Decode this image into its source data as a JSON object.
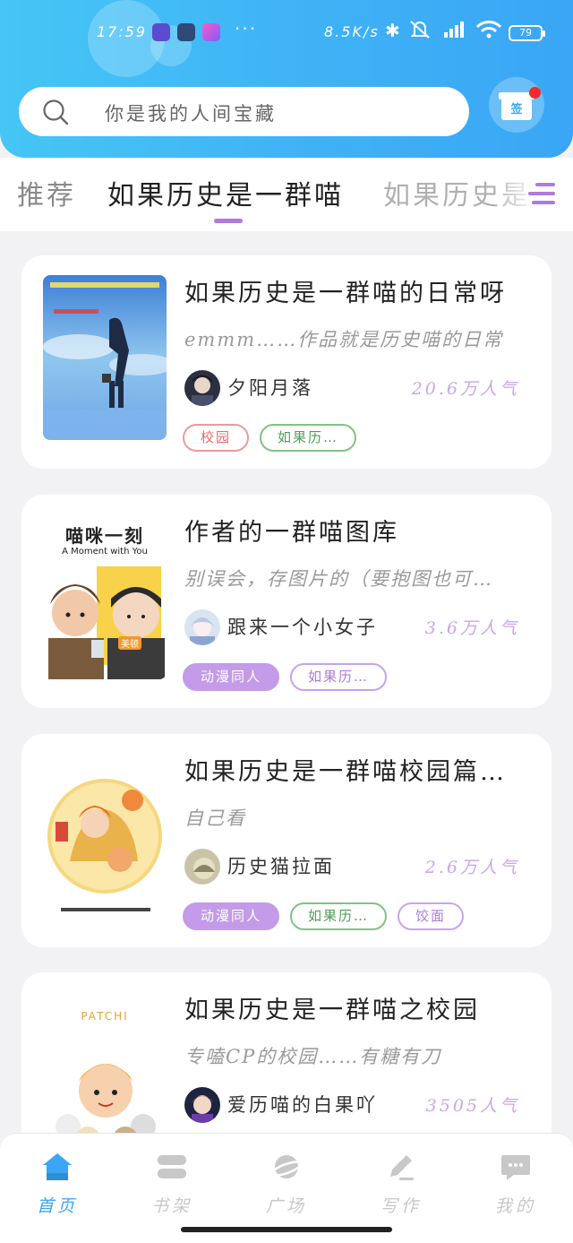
{
  "colors": {
    "header": "#3fb2f6",
    "accent_purple": "#b07adf",
    "tab_active": "#3aa6f5",
    "tab_inactive": "#c8c8c8"
  },
  "status_bar": {
    "time": "17:59",
    "network_speed": "8.5K/s",
    "battery": "79",
    "more": "···"
  },
  "search": {
    "placeholder": "你是我的人间宝藏",
    "icon": "search-icon"
  },
  "sign_in": {
    "label": "签",
    "icon": "gift-icon"
  },
  "category_tabs": [
    {
      "label": "推荐",
      "active": false
    },
    {
      "label": "如果历史是一群喵",
      "active": true
    },
    {
      "label": "如果历史是",
      "active": false
    }
  ],
  "books": [
    {
      "title": "如果历史是一群喵的日常呀",
      "description": "emmm……作品就是历史喵的日常",
      "author": "夕阳月落",
      "popularity": "20.6万人气",
      "tags": [
        {
          "label": "校园",
          "style": "red"
        },
        {
          "label": "如果历…",
          "style": "green"
        }
      ]
    },
    {
      "title": "作者的一群喵图库",
      "description": "别误会，存图片的（要抱图也可…",
      "author": "跟来一个小女子",
      "popularity": "3.6万人气",
      "cover_text": {
        "title": "喵咪一刻",
        "subtitle": "A Moment with You",
        "badge": "美顿"
      },
      "tags": [
        {
          "label": "动漫同人",
          "style": "purple-fill"
        },
        {
          "label": "如果历…",
          "style": "purple"
        }
      ]
    },
    {
      "title": "如果历史是一群喵校园篇…",
      "description": "自己看",
      "author": "历史猫拉面",
      "popularity": "2.6万人气",
      "tags": [
        {
          "label": "动漫同人",
          "style": "purple-fill"
        },
        {
          "label": "如果历…",
          "style": "green"
        },
        {
          "label": "饺面",
          "style": "purple"
        }
      ]
    },
    {
      "title": "如果历史是一群喵之校园",
      "description": "专嗑CP的校园……有糖有刀",
      "author": "爱历喵的白果吖",
      "popularity": "3505人气",
      "cover_text": {
        "title": "PATCHI"
      },
      "tags": []
    }
  ],
  "tab_bar": [
    {
      "label": "首页",
      "icon": "home-icon",
      "active": true
    },
    {
      "label": "书架",
      "icon": "bookshelf-icon",
      "active": false
    },
    {
      "label": "广场",
      "icon": "planet-icon",
      "active": false
    },
    {
      "label": "写作",
      "icon": "pen-icon",
      "active": false
    },
    {
      "label": "我的",
      "icon": "chat-bubble-icon",
      "active": false
    }
  ]
}
